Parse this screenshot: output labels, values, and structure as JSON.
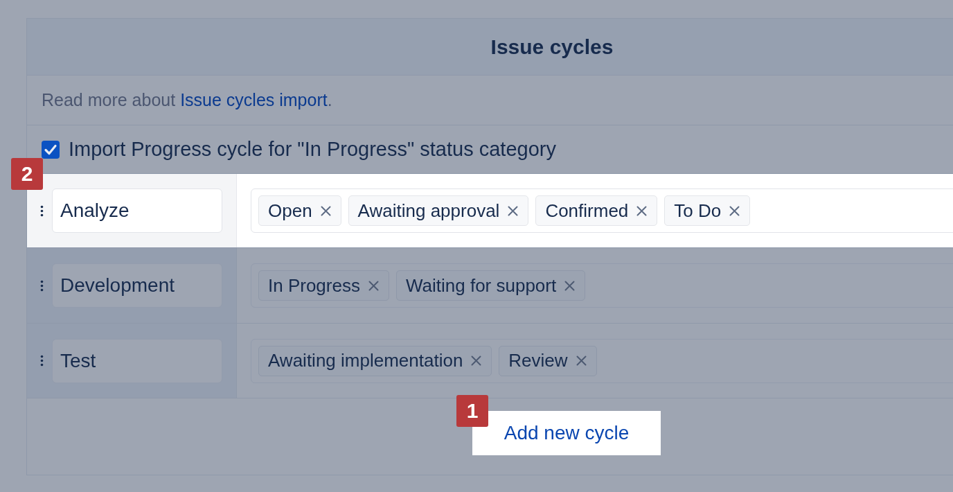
{
  "panel": {
    "title": "Issue cycles"
  },
  "info": {
    "text_before": "Read more about ",
    "link": "Issue cycles import",
    "text_after": "."
  },
  "import_option": {
    "label": "Import Progress cycle for \"In Progress\" status category",
    "checked": true
  },
  "cycles": [
    {
      "name": "Analyze",
      "highlighted": true,
      "callout": "2",
      "statuses": [
        "Open",
        "Awaiting approval",
        "Confirmed",
        "To Do"
      ]
    },
    {
      "name": "Development",
      "highlighted": false,
      "statuses": [
        "In Progress",
        "Waiting for support"
      ]
    },
    {
      "name": "Test",
      "highlighted": false,
      "statuses": [
        "Awaiting implementation",
        "Review"
      ]
    }
  ],
  "add_button": {
    "label": "Add new cycle",
    "highlighted": true,
    "callout": "1"
  }
}
